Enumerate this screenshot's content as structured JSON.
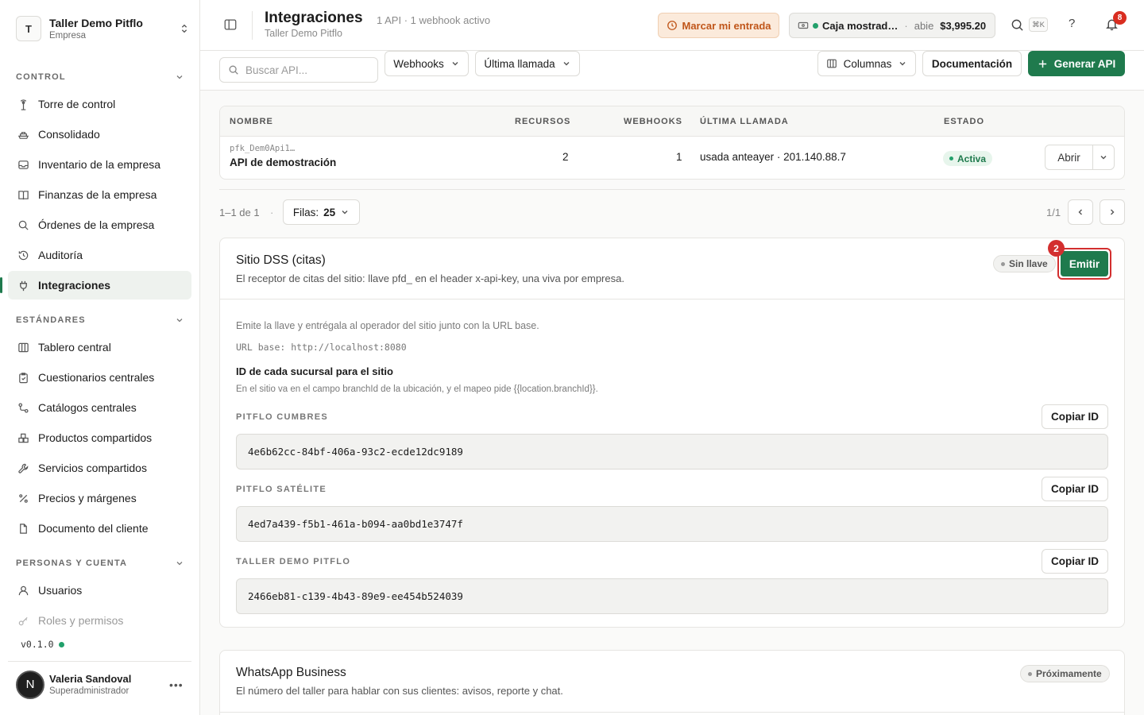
{
  "workspace": {
    "initial": "T",
    "name": "Taller Demo Pitflo",
    "type": "Empresa"
  },
  "sidebar": {
    "sections": [
      {
        "title": "CONTROL"
      },
      {
        "title": "ESTÁNDARES"
      },
      {
        "title": "PERSONAS Y CUENTA"
      }
    ],
    "items": [
      {
        "label": "Torre de control",
        "icon": "tower-icon"
      },
      {
        "label": "Consolidado",
        "icon": "ship-icon"
      },
      {
        "label": "Inventario de la empresa",
        "icon": "inbox-icon"
      },
      {
        "label": "Finanzas de la empresa",
        "icon": "book-icon"
      },
      {
        "label": "Órdenes de la empresa",
        "icon": "search-icon"
      },
      {
        "label": "Auditoría",
        "icon": "history-icon"
      },
      {
        "label": "Integraciones",
        "icon": "plug-icon",
        "active": true
      },
      {
        "label": "Tablero central",
        "icon": "columns-icon"
      },
      {
        "label": "Cuestionarios centrales",
        "icon": "clipboard-icon"
      },
      {
        "label": "Catálogos centrales",
        "icon": "route-icon"
      },
      {
        "label": "Productos compartidos",
        "icon": "boxes-icon"
      },
      {
        "label": "Servicios compartidos",
        "icon": "wrench-icon"
      },
      {
        "label": "Precios y márgenes",
        "icon": "percent-icon"
      },
      {
        "label": "Documento del cliente",
        "icon": "document-icon"
      },
      {
        "label": "Usuarios",
        "icon": "user-icon"
      },
      {
        "label": "Roles y permisos",
        "icon": "key-icon"
      }
    ],
    "version": "v0.1.0"
  },
  "user": {
    "initial": "N",
    "name": "Valeria Sandoval",
    "role": "Superadministrador"
  },
  "header": {
    "title": "Integraciones",
    "meta": "1 API · 1 webhook activo",
    "subtitle": "Taller Demo Pitflo",
    "clockin_label": "Marcar mi entrada",
    "register": {
      "name": "Caja mostrad…",
      "separator": "·",
      "status": "abie",
      "amount": "$3,995.20"
    },
    "shortcut": "⌘K",
    "help": "?",
    "notifications": "8"
  },
  "toolbar": {
    "search_placeholder": "Buscar API...",
    "webhooks_label": "Webhooks",
    "lastcall_label": "Última llamada",
    "columns_label": "Columnas",
    "docs_label": "Documentación",
    "generate_label": "Generar API"
  },
  "table": {
    "headers": [
      "NOMBRE",
      "RECURSOS",
      "WEBHOOKS",
      "ÚLTIMA LLAMADA",
      "ESTADO"
    ],
    "rows": [
      {
        "key": "pfk_Dem0Api1…",
        "name": "API de demostración",
        "resources": "2",
        "webhooks": "1",
        "last_call": "usada anteayer · 201.140.88.7",
        "status": "Activa",
        "action": "Abrir"
      }
    ]
  },
  "pagination": {
    "range": "1–1 de 1",
    "dot": "·",
    "rows_label": "Filas:",
    "rows_value": "25",
    "page": "1/1"
  },
  "dss": {
    "title": "Sitio DSS (citas)",
    "description": "El receptor de citas del sitio: llave pfd_ en el header x-api-key, una viva por empresa.",
    "key_status": "Sin llave",
    "emit_label": "Emitir",
    "emit_step": "2",
    "hint": "Emite la llave y entrégala al operador del sitio junto con la URL base.",
    "base_url": "URL base: http://localhost:8080",
    "ids_title": "ID de cada sucursal para el sitio",
    "ids_hint": "En el sitio va en el campo branchId de la ubicación, y el mapeo pide {{location.branchId}}.",
    "copy_label": "Copiar ID",
    "branches": [
      {
        "label": "PITFLO CUMBRES",
        "id": "4e6b62cc-84bf-406a-93c2-ecde12dc9189"
      },
      {
        "label": "PITFLO SATÉLITE",
        "id": "4ed7a439-f5b1-461a-b094-aa0bd1e3747f"
      },
      {
        "label": "TALLER DEMO PITFLO",
        "id": "2466eb81-c139-4b43-89e9-ee454b524039"
      }
    ]
  },
  "whatsapp": {
    "title": "WhatsApp Business",
    "description": "El número del taller para hablar con sus clientes: avisos, reporte y chat.",
    "status": "Próximamente"
  }
}
